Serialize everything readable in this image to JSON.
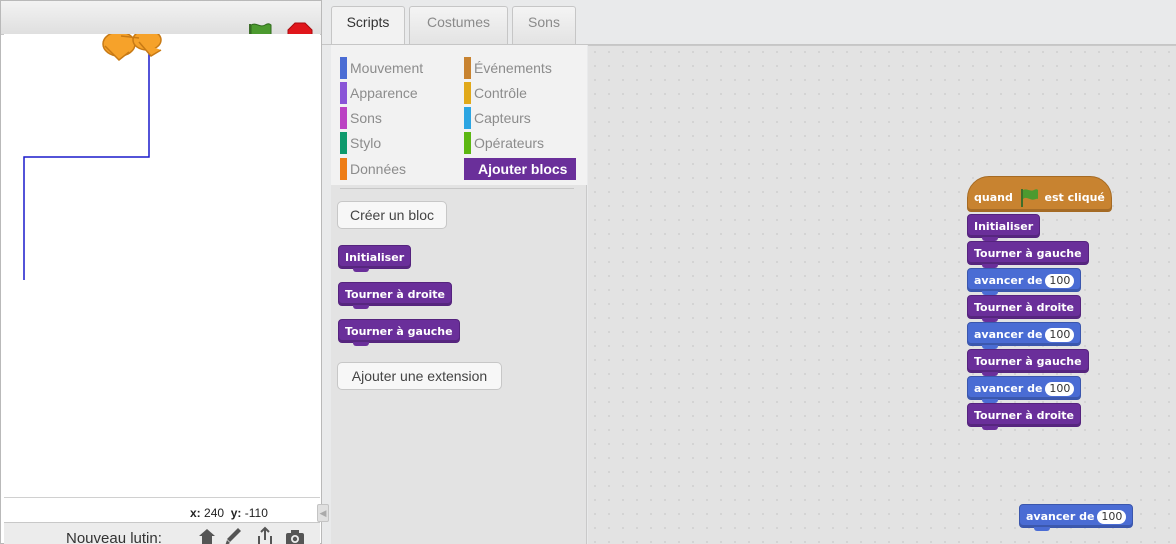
{
  "stage": {
    "coords": {
      "x_label": "x:",
      "x_value": "240",
      "y_label": "y:",
      "y_value": "-110"
    },
    "new_sprite_label": "Nouveau lutin:",
    "icons": [
      "green-flag-icon",
      "stop-icon",
      "sprite-library-icon",
      "paint-brush-icon",
      "upload-icon",
      "camera-icon"
    ]
  },
  "tabs": [
    {
      "label": "Scripts",
      "active": true
    },
    {
      "label": "Costumes",
      "active": false
    },
    {
      "label": "Sons",
      "active": false
    }
  ],
  "categories": [
    {
      "label": "Mouvement",
      "color": "#4a6cd4"
    },
    {
      "label": "Événements",
      "color": "#c88330"
    },
    {
      "label": "Apparence",
      "color": "#8a55d7"
    },
    {
      "label": "Contrôle",
      "color": "#e1a91a"
    },
    {
      "label": "Sons",
      "color": "#bb42c3"
    },
    {
      "label": "Capteurs",
      "color": "#2ca5e2"
    },
    {
      "label": "Stylo",
      "color": "#0e9a6c"
    },
    {
      "label": "Opérateurs",
      "color": "#5cb712"
    },
    {
      "label": "Données",
      "color": "#ee7d16"
    },
    {
      "label": "Ajouter blocs",
      "color": "#6a2f9a",
      "selected": true
    }
  ],
  "palette": {
    "create_block_label": "Créer un bloc",
    "blocks": [
      "Initialiser",
      "Tourner à droite",
      "Tourner à gauche"
    ],
    "add_extension_label": "Ajouter une extension"
  },
  "script": {
    "hat": {
      "prefix": "quand",
      "suffix": "est cliqué"
    },
    "stack": [
      {
        "label": "Initialiser",
        "kind": "custom"
      },
      {
        "label": "Tourner à gauche",
        "kind": "custom"
      },
      {
        "label": "avancer de",
        "kind": "motion",
        "value": "100"
      },
      {
        "label": "Tourner à droite",
        "kind": "custom"
      },
      {
        "label": "avancer de",
        "kind": "motion",
        "value": "100"
      },
      {
        "label": "Tourner à gauche",
        "kind": "custom"
      },
      {
        "label": "avancer de",
        "kind": "motion",
        "value": "100"
      },
      {
        "label": "Tourner à droite",
        "kind": "custom"
      }
    ],
    "loose_block": {
      "label": "avancer de",
      "value": "100"
    }
  },
  "colors": {
    "custom": "#6a2f9a",
    "motion": "#4a6cd4",
    "event": "#c88330",
    "pen_line": "#1a1acc"
  }
}
